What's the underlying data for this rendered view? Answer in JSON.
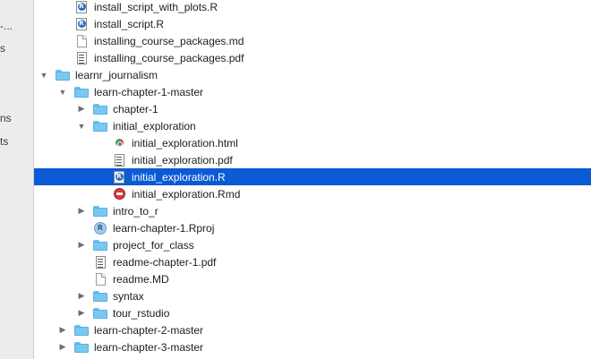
{
  "sidebar": {
    "items": [
      "-...",
      "s",
      "ns",
      "ts"
    ]
  },
  "rows": [
    {
      "name": "install_script_with_plots.R",
      "icon": "r-script-icon",
      "toggle": "none",
      "depth": 1,
      "selected": false
    },
    {
      "name": "install_script.R",
      "icon": "r-script-icon",
      "toggle": "none",
      "depth": 1,
      "selected": false
    },
    {
      "name": "installing_course_packages.md",
      "icon": "document-icon",
      "toggle": "none",
      "depth": 1,
      "selected": false
    },
    {
      "name": "installing_course_packages.pdf",
      "icon": "pdf-icon",
      "toggle": "none",
      "depth": 1,
      "selected": false
    },
    {
      "name": "learnr_journalism",
      "icon": "folder-icon",
      "toggle": "down",
      "depth": 0,
      "selected": false
    },
    {
      "name": "learn-chapter-1-master",
      "icon": "folder-icon",
      "toggle": "down",
      "depth": 1,
      "selected": false
    },
    {
      "name": "chapter-1",
      "icon": "folder-icon",
      "toggle": "right",
      "depth": 2,
      "selected": false
    },
    {
      "name": "initial_exploration",
      "icon": "folder-icon",
      "toggle": "down",
      "depth": 2,
      "selected": false
    },
    {
      "name": "initial_exploration.html",
      "icon": "html-icon",
      "toggle": "none",
      "depth": 3,
      "selected": false
    },
    {
      "name": "initial_exploration.pdf",
      "icon": "pdf-icon",
      "toggle": "none",
      "depth": 3,
      "selected": false
    },
    {
      "name": "initial_exploration.R",
      "icon": "r-script-icon",
      "toggle": "none",
      "depth": 3,
      "selected": true
    },
    {
      "name": "initial_exploration.Rmd",
      "icon": "rmd-icon",
      "toggle": "none",
      "depth": 3,
      "selected": false
    },
    {
      "name": "intro_to_r",
      "icon": "folder-icon",
      "toggle": "right",
      "depth": 2,
      "selected": false
    },
    {
      "name": "learn-chapter-1.Rproj",
      "icon": "rproj-icon",
      "toggle": "none",
      "depth": 2,
      "selected": false
    },
    {
      "name": "project_for_class",
      "icon": "folder-icon",
      "toggle": "right",
      "depth": 2,
      "selected": false
    },
    {
      "name": "readme-chapter-1.pdf",
      "icon": "pdf-icon",
      "toggle": "none",
      "depth": 2,
      "selected": false
    },
    {
      "name": "readme.MD",
      "icon": "document-icon",
      "toggle": "none",
      "depth": 2,
      "selected": false
    },
    {
      "name": "syntax",
      "icon": "folder-icon",
      "toggle": "right",
      "depth": 2,
      "selected": false
    },
    {
      "name": "tour_rstudio",
      "icon": "folder-icon",
      "toggle": "right",
      "depth": 2,
      "selected": false
    },
    {
      "name": "learn-chapter-2-master",
      "icon": "folder-icon",
      "toggle": "right",
      "depth": 1,
      "selected": false
    },
    {
      "name": "learn-chapter-3-master",
      "icon": "folder-icon",
      "toggle": "right",
      "depth": 1,
      "selected": false
    }
  ],
  "colors": {
    "selection": "#0b5ad6",
    "folder": "#79c8f2",
    "sidebar_bg": "#ececec"
  }
}
